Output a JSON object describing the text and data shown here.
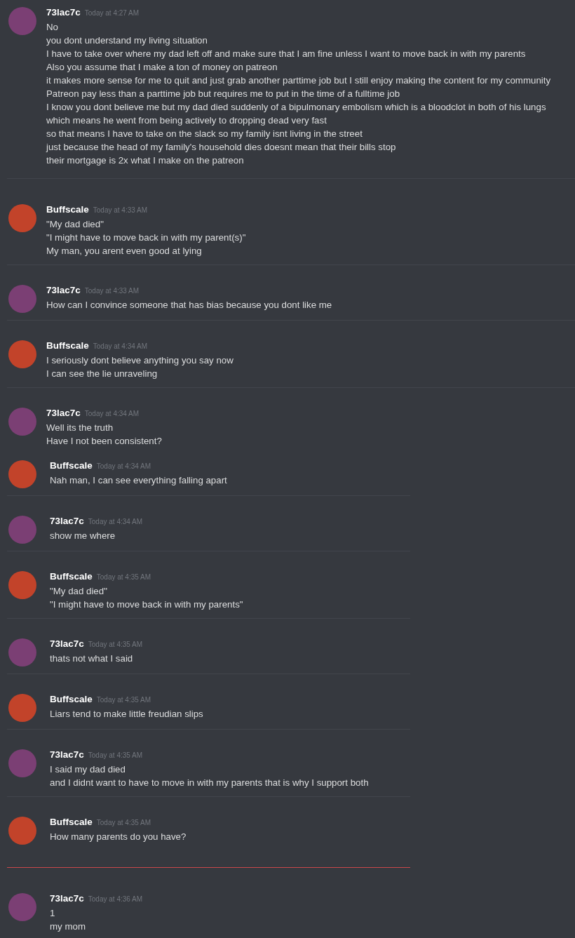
{
  "segments": [
    {
      "kind": "full",
      "messages": [
        {
          "author": "73lac7c",
          "time": "Today at 4:27 AM",
          "color": "#7b3f74",
          "new_marker": false,
          "lines": [
            "No",
            "you dont understand my living situation",
            "I have to take over where my dad left off and make sure that I am fine unless I want to move back in with my parents",
            "Also you assume that I make a ton of money on patreon",
            "it makes more sense for me to quit and just grab another parttime job but I still enjoy making the content for my community",
            "Patreon pay less than a parttime job but requires me to put in the time of a fulltime job",
            "I know you dont believe me but my dad died suddenly of a bipulmonary embolism which is a bloodclot in both of his lungs",
            "which means he went from being actively to dropping dead very fast",
            "so that means I have to take on the slack so my family isnt living in the street",
            "just because the head of my family's household dies doesnt mean that their bills stop",
            "their mortgage is 2x what I make on the patreon"
          ]
        },
        {
          "author": "Buffscale",
          "time": "Today at 4:33 AM",
          "color": "#c2432a",
          "new_marker": false,
          "lines": [
            "\"My dad died\"",
            "\"I might have to move back in with my parent(s)\"",
            "My man, you arent even good at lying"
          ]
        },
        {
          "author": "73lac7c",
          "time": "Today at 4:33 AM",
          "color": "#7b3f74",
          "new_marker": false,
          "lines": [
            "How can I convince someone that has bias because you dont like me"
          ]
        },
        {
          "author": "Buffscale",
          "time": "Today at 4:34 AM",
          "color": "#c2432a",
          "new_marker": false,
          "lines": [
            "I seriously dont believe anything you say now",
            "I can see the lie unraveling"
          ]
        },
        {
          "author": "73lac7c",
          "time": "Today at 4:34 AM",
          "color": "#7b3f74",
          "new_marker": false,
          "lines": [
            "Well its the truth",
            "Have I not been consistent?"
          ]
        }
      ]
    },
    {
      "kind": "cropped",
      "messages": [
        {
          "author": "Buffscale",
          "time": "Today at 4:34 AM",
          "color": "#c2432a",
          "new_marker": false,
          "lines": [
            "Nah man, I can see everything falling apart"
          ]
        },
        {
          "author": "73lac7c",
          "time": "Today at 4:34 AM",
          "color": "#7b3f74",
          "new_marker": false,
          "lines": [
            "show me where"
          ]
        },
        {
          "author": "Buffscale",
          "time": "Today at 4:35 AM",
          "color": "#c2432a",
          "new_marker": false,
          "lines": [
            "\"My dad died\"",
            "\"I might have to move back in with my parents\""
          ]
        },
        {
          "author": "73lac7c",
          "time": "Today at 4:35 AM",
          "color": "#7b3f74",
          "new_marker": false,
          "lines": [
            "thats not what I said"
          ]
        },
        {
          "author": "Buffscale",
          "time": "Today at 4:35 AM",
          "color": "#c2432a",
          "new_marker": false,
          "lines": [
            "Liars tend to make little freudian slips"
          ]
        },
        {
          "author": "73lac7c",
          "time": "Today at 4:35 AM",
          "color": "#7b3f74",
          "new_marker": false,
          "lines": [
            "I said my dad died",
            "and I didnt want to have to move in with my parents that is why I support both"
          ]
        },
        {
          "author": "Buffscale",
          "time": "Today at 4:35 AM",
          "color": "#c2432a",
          "new_marker": false,
          "lines": [
            "How many parents do you have?"
          ]
        },
        {
          "author": "73lac7c",
          "time": "Today at 4:36 AM",
          "color": "#7b3f74",
          "new_marker": true,
          "lines": [
            "1",
            "my mom"
          ]
        }
      ]
    }
  ]
}
